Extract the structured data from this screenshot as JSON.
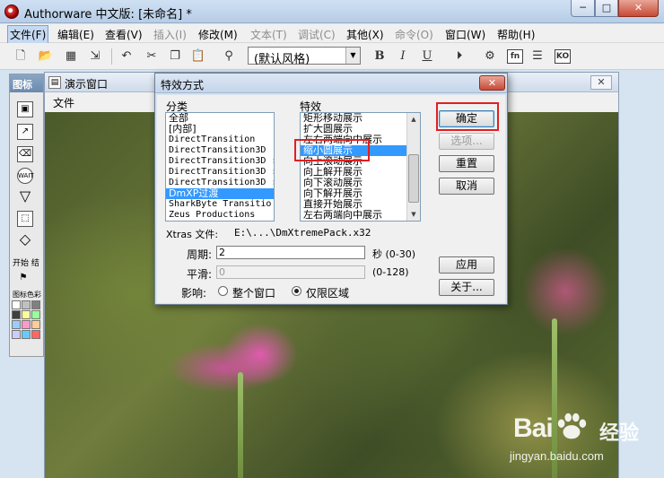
{
  "app": {
    "title": "Authorware 中文版: [未命名] *",
    "min_glyph": "─",
    "max_glyph": "□",
    "close_glyph": "✕"
  },
  "menu": [
    "文件(F)",
    "编辑(E)",
    "查看(V)",
    "插入(I)",
    "修改(M)",
    "文本(T)",
    "调试(C)",
    "其他(X)",
    "命令(O)",
    "窗口(W)",
    "帮助(H)"
  ],
  "toolbar": {
    "style_combo_value": "(默认风格)",
    "bold": "B",
    "italic": "I",
    "underline": "U",
    "fn_label": "fn",
    "ko_label": "KO"
  },
  "palette": {
    "title": "图标",
    "start_label": "开始 结",
    "color_label": "图标色彩",
    "wait_label": "WAIT",
    "swatch_colors": [
      "#ffffff",
      "#c0c0c0",
      "#808080",
      "#404040",
      "#ffff99",
      "#99ff99",
      "#99ccff",
      "#ff99cc",
      "#ffcc99",
      "#ccccff",
      "#66ccff",
      "#ff6666"
    ]
  },
  "presentation": {
    "title": "演示窗口",
    "menu_file": "文件",
    "close_glyph": "✕"
  },
  "dialog": {
    "title": "特效方式",
    "close_glyph": "✕",
    "category_label": "分类",
    "effects_label": "特效",
    "categories": [
      "全部",
      "[内部]",
      "DirectTransition",
      "DirectTransition3D",
      "DirectTransition3D :",
      "DirectTransition3D :",
      "DirectTransition3D :",
      "DmXP过渡",
      "SharkByte Transitio",
      "Zeus Productions"
    ],
    "selected_category_index": 7,
    "effects": [
      "矩形移动展示",
      "扩大圆展示",
      "左右两端向中展示",
      "缩小圆展示",
      "向上滚动展示",
      "向上解开展示",
      "向下滚动展示",
      "向下解开展示",
      "直接开始展示",
      "左右两端向中展示"
    ],
    "selected_effect_index": 3,
    "xtras_label": "Xtras 文件:",
    "xtras_path": "E:\\...\\DmXtremePack.x32",
    "period_label": "周期:",
    "period_value": "2",
    "period_unit": "秒 (0-30)",
    "smooth_label": "平滑:",
    "smooth_value": "0",
    "smooth_range": "(0-128)",
    "affect_label": "影响:",
    "radio_whole": "整个窗口",
    "radio_area": "仅限区域",
    "btn_ok": "确定",
    "btn_options": "选项...",
    "btn_reset": "重置",
    "btn_cancel": "取消",
    "btn_apply": "应用",
    "btn_about": "关于..."
  },
  "watermark": {
    "brand": "Bai",
    "brand_cn": "经验",
    "url": "jingyan.baidu.com"
  }
}
